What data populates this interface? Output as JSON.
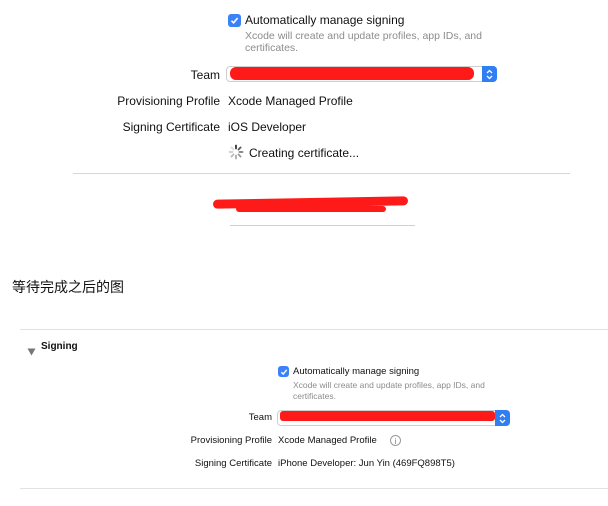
{
  "top": {
    "auto_signing_label": "Automatically manage signing",
    "auto_signing_desc_1": "Xcode will create and update profiles, app IDs, and",
    "auto_signing_desc_2": "certificates.",
    "team_label": "Team",
    "provisioning_label": "Provisioning Profile",
    "provisioning_value": "Xcode Managed Profile",
    "signing_cert_label": "Signing Certificate",
    "signing_cert_value": "iOS Developer",
    "status_text": "Creating certificate..."
  },
  "caption": "等待完成之后的图",
  "bottom": {
    "section_title": "Signing",
    "auto_signing_label": "Automatically manage signing",
    "auto_signing_desc_1": "Xcode will create and update profiles, app IDs, and",
    "auto_signing_desc_2": "certificates.",
    "team_label": "Team",
    "provisioning_label": "Provisioning Profile",
    "provisioning_value": "Xcode Managed Profile",
    "signing_cert_label": "Signing Certificate",
    "signing_cert_value": "iPhone Developer: Jun Yin (469FQ898T5)"
  },
  "colors": {
    "accent": "#3b82f6",
    "redaction": "#ff1a1a"
  }
}
